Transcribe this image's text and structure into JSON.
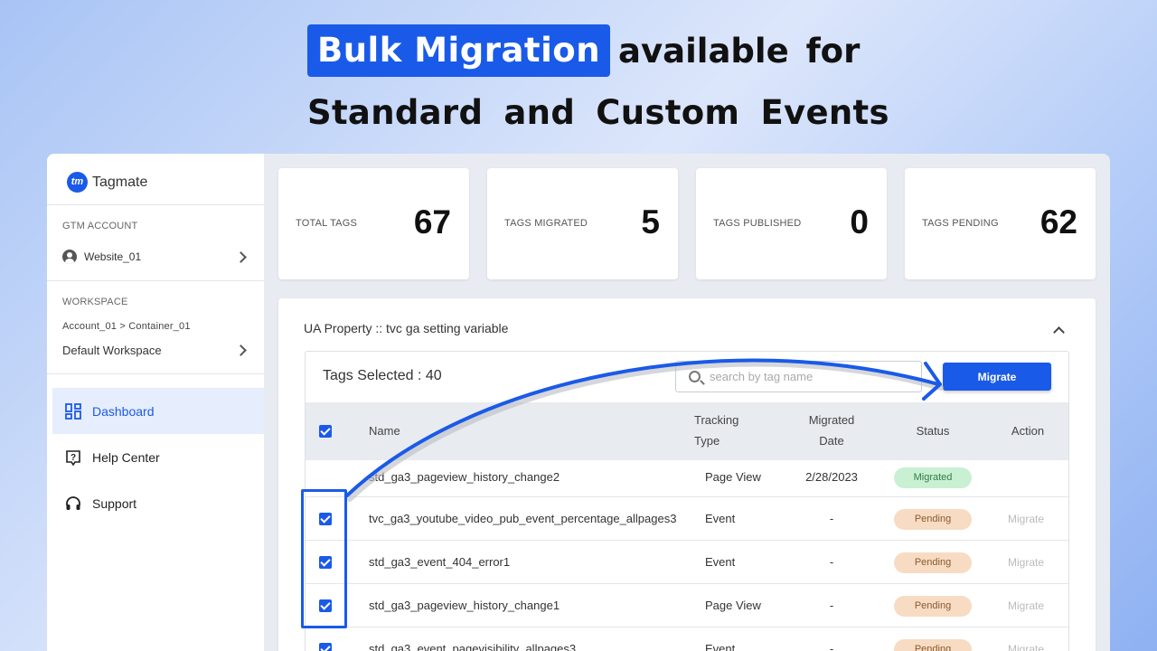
{
  "hero": {
    "highlight": "Bulk Migration",
    "line1_rest": "available for",
    "line2": "Standard and Custom Events"
  },
  "sidebar": {
    "brand": "Tagmate",
    "brand_mark": "tm",
    "gtm_account_caption": "GTM ACCOUNT",
    "gtm_account_value": "Website_01",
    "workspace_caption": "WORKSPACE",
    "workspace_path": "Account_01 > Container_01",
    "workspace_value": "Default Workspace",
    "nav": [
      {
        "label": "Dashboard",
        "icon": "dashboard-icon",
        "active": true
      },
      {
        "label": "Help Center",
        "icon": "help-icon",
        "active": false
      },
      {
        "label": "Support",
        "icon": "headset-icon",
        "active": false
      }
    ]
  },
  "stats": [
    {
      "label": "TOTAL TAGS",
      "value": "67"
    },
    {
      "label": "TAGS MIGRATED",
      "value": "5"
    },
    {
      "label": "TAGS PUBLISHED",
      "value": "0"
    },
    {
      "label": "TAGS PENDING",
      "value": "62"
    }
  ],
  "panel": {
    "title": "UA Property :: tvc ga setting variable",
    "tags_selected": "Tags Selected : 40",
    "search_placeholder": "search by tag name",
    "migrate_button": "Migrate",
    "columns": {
      "name": "Name",
      "tracking_type_1": "Tracking",
      "tracking_type_2": "Type",
      "migrated_date_1": "Migrated",
      "migrated_date_2": "Date",
      "status": "Status",
      "action": "Action"
    },
    "rows": [
      {
        "checked": false,
        "name": "std_ga3_pageview_history_change2",
        "type": "Page View",
        "date": "2/28/2023",
        "status": "Migrated",
        "action": ""
      },
      {
        "checked": true,
        "name": "tvc_ga3_youtube_video_pub_event_percentage_allpages3",
        "type": "Event",
        "date": "-",
        "status": "Pending",
        "action": "Migrate"
      },
      {
        "checked": true,
        "name": "std_ga3_event_404_error1",
        "type": "Event",
        "date": "-",
        "status": "Pending",
        "action": "Migrate"
      },
      {
        "checked": true,
        "name": "std_ga3_pageview_history_change1",
        "type": "Page View",
        "date": "-",
        "status": "Pending",
        "action": "Migrate"
      },
      {
        "checked": true,
        "name": "std_ga3_event_pagevisibility_allpages3",
        "type": "Event",
        "date": "-",
        "status": "Pending",
        "action": "Migrate"
      }
    ]
  },
  "colors": {
    "accent": "#1a5ae8",
    "migrated_bg": "#c9f0d2",
    "pending_bg": "#f7dcc3"
  }
}
